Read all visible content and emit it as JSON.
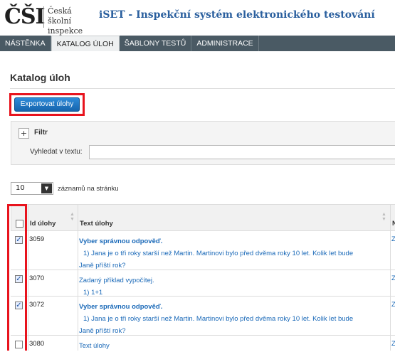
{
  "header": {
    "logo_mark": "ČŠI",
    "logo_line1": "Česká školní",
    "logo_line2": "inspekce",
    "app_title": "iSET - Inspekční systém elektronického testování"
  },
  "nav": [
    {
      "label": "NÁSTĚNKA"
    },
    {
      "label": "KATALOG ÚLOH"
    },
    {
      "label": "ŠABLONY TESTŮ"
    },
    {
      "label": "ADMINISTRACE"
    }
  ],
  "page": {
    "title": "Katalog úloh",
    "export_label": "Exportovat úlohy"
  },
  "filter": {
    "toggle": "+",
    "label": "Filtr",
    "search_label": "Vyhledat v textu:",
    "search_value": ""
  },
  "perpage": {
    "value": "10",
    "suffix": "záznamů na stránku"
  },
  "table": {
    "col_id": "Id úlohy",
    "col_text": "Text úlohy",
    "col_next": "N",
    "sort_icon": "sort-arrows-icon",
    "rows": [
      {
        "checked": true,
        "id": "3059",
        "title": "Vyber správnou odpověď.",
        "title_bold": true,
        "sub1": "1) Jana je o tři roky starší než Martin. Martinovi bylo před dvěma roky 10 let. Kolik let bude",
        "sub2": "Janě příští rok?",
        "z": "Z"
      },
      {
        "checked": true,
        "id": "3070",
        "title": "Zadaný příklad vypočítej.",
        "title_bold": false,
        "sub1": "1) 1+1",
        "sub2": "",
        "z": "Z"
      },
      {
        "checked": true,
        "id": "3072",
        "title": "Vyber správnou odpověď.",
        "title_bold": true,
        "sub1": "1) Jana je o tři roky starší než Martin. Martinovi bylo před dvěma roky 10 let. Kolik let bude",
        "sub2": "Janě příští rok?",
        "z": "Z"
      },
      {
        "checked": false,
        "id": "3080",
        "title": "Text úlohy",
        "title_bold": false,
        "sub1": "",
        "sub2": "",
        "z": "Z"
      }
    ]
  },
  "colors": {
    "nav_bg": "#4a5a64",
    "accent": "#1a69b8",
    "highlight": "#e8131d"
  }
}
